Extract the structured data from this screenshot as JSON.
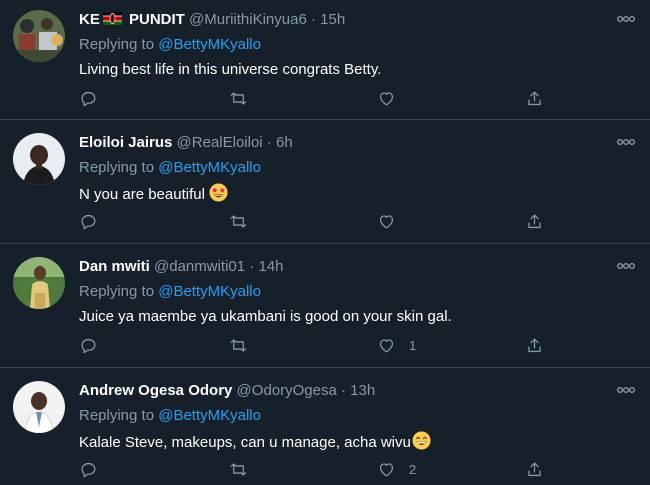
{
  "colors": {
    "background": "#15202b",
    "divider": "#38444d",
    "secondary_text": "#8899a6",
    "link": "#1da1f2",
    "primary_text": "#ffffff"
  },
  "replying_to_label": "Replying to",
  "tweets": [
    {
      "display_name_prefix": "KE",
      "display_name": "PUNDIT",
      "name_flag_icon": "kenya-flag-icon",
      "handle": "@MuriithiKinyua6",
      "separator": "·",
      "time": "15h",
      "replying_to": "@BettyMKyallo",
      "text": "Living best life in this universe congrats Betty.",
      "reply_count": "",
      "retweet_count": "",
      "like_count": ""
    },
    {
      "display_name": "Eloiloi Jairus",
      "handle": "@RealEloiloi",
      "separator": "·",
      "time": "6h",
      "replying_to": "@BettyMKyallo",
      "text": "N you are beautiful",
      "text_emoji_icon": "star-struck-emoji-icon",
      "reply_count": "",
      "retweet_count": "",
      "like_count": ""
    },
    {
      "display_name": "Dan mwiti",
      "handle": "@danmwiti01",
      "separator": "·",
      "time": "14h",
      "replying_to": "@BettyMKyallo",
      "text": "Juice ya maembe ya ukambani is good on your skin gal.",
      "reply_count": "",
      "retweet_count": "",
      "like_count": "1"
    },
    {
      "display_name": "Andrew Ogesa Odory",
      "handle": "@OdoryOgesa",
      "separator": "·",
      "time": "13h",
      "replying_to": "@BettyMKyallo",
      "text": "Kalale Steve, makeups, can u manage, acha wivu",
      "text_emoji_icon": "grinning-emoji-icon",
      "reply_count": "",
      "retweet_count": "",
      "like_count": "2"
    }
  ]
}
